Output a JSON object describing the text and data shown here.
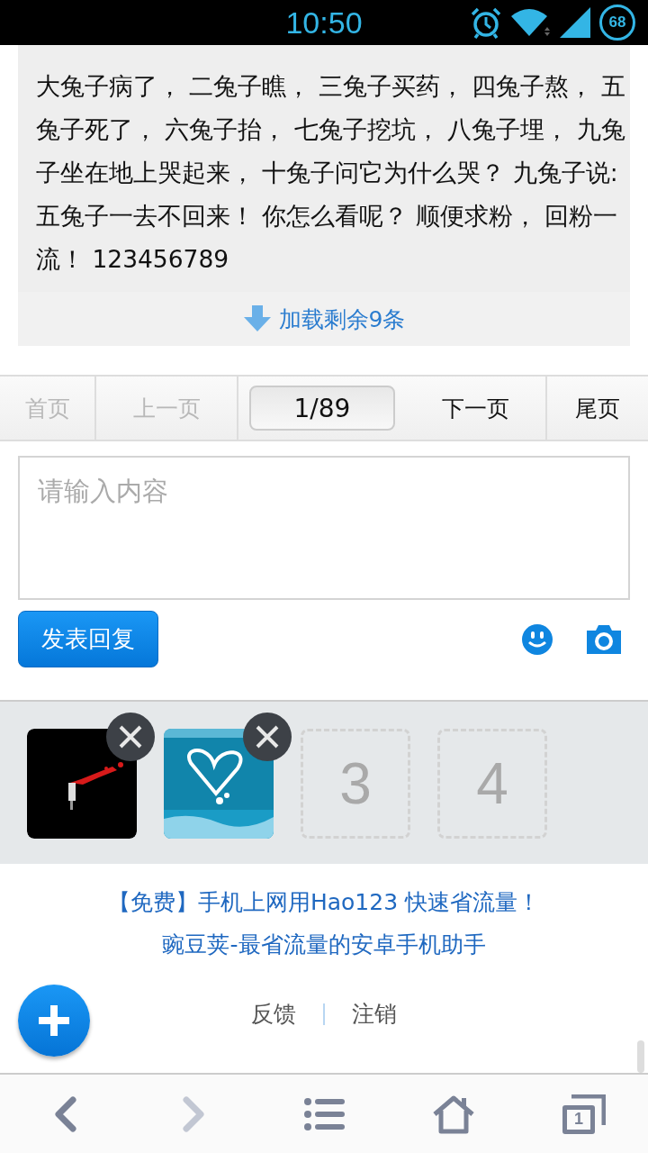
{
  "status_bar": {
    "time": "10:50",
    "battery": "68"
  },
  "post": {
    "text": "大兔子病了， 二兔子瞧， 三兔子买药， 四兔子熬， 五兔子死了， 六兔子抬， 七兔子挖坑， 八兔子埋， 九兔子坐在地上哭起来， 十兔子问它为什么哭？ 九兔子说: 五兔子一去不回来！ 你怎么看呢？ 顺便求粉， 回粉一流！ 123456789",
    "load_more": "加载剩余9条"
  },
  "pager": [
    {
      "label": "首页",
      "kind": "link",
      "disabled": true
    },
    {
      "label": "上一页",
      "kind": "link",
      "disabled": true
    },
    {
      "label": "1/89",
      "kind": "current"
    },
    {
      "label": "下一页",
      "kind": "link",
      "disabled": false
    },
    {
      "label": "尾页",
      "kind": "link",
      "disabled": false
    }
  ],
  "reply": {
    "placeholder": "请输入内容",
    "submit": "发表回复"
  },
  "uploads": [
    {
      "kind": "picture"
    },
    {
      "kind": "picture"
    },
    {
      "kind": "empty",
      "label": "3"
    },
    {
      "kind": "empty",
      "label": "4"
    }
  ],
  "ads": [
    "【免费】手机上网用Hao123 快速省流量！",
    "豌豆荚-最省流量的安卓手机助手"
  ],
  "footer_links": [
    "反馈",
    "注销"
  ],
  "browser_nav": [
    {
      "kind": "back",
      "disabled": false
    },
    {
      "kind": "forward",
      "disabled": true
    },
    {
      "kind": "menu",
      "disabled": false
    },
    {
      "kind": "home",
      "disabled": false
    },
    {
      "kind": "tabs",
      "disabled": false,
      "count": "1"
    }
  ]
}
